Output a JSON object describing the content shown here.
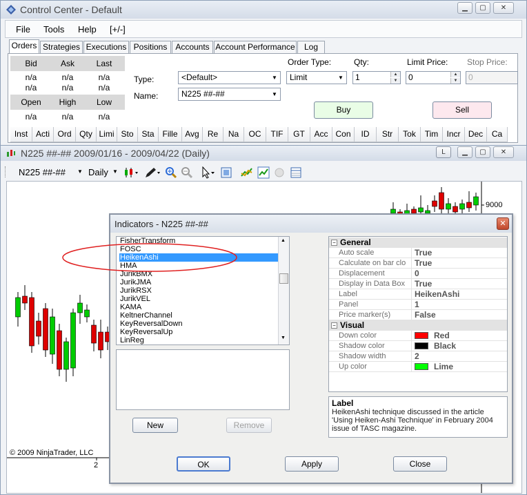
{
  "control_center": {
    "title": "Control Center - Default",
    "menu": [
      "File",
      "Tools",
      "Help",
      "[+/-]"
    ],
    "tabs": [
      "Orders",
      "Strategies",
      "Executions",
      "Positions",
      "Accounts",
      "Account Performance",
      "Log"
    ],
    "quote": {
      "row1_headers": [
        "Bid",
        "Ask",
        "Last"
      ],
      "row1_values": [
        "n/a",
        "n/a",
        "n/a"
      ],
      "row1_values_b": [
        "n/a",
        "n/a",
        "n/a"
      ],
      "row2_headers": [
        "Open",
        "High",
        "Low"
      ],
      "row2_values": [
        "n/a",
        "n/a",
        "n/a"
      ]
    },
    "order_entry": {
      "type_label": "Type:",
      "type_value": "<Default>",
      "name_label": "Name:",
      "name_value": "N225 ##-##",
      "order_type_label": "Order Type:",
      "order_type_value": "Limit",
      "qty_label": "Qty:",
      "qty_value": "1",
      "limit_price_label": "Limit Price:",
      "limit_price_value": "0",
      "stop_price_label": "Stop Price:",
      "stop_price_value": "0",
      "buy_label": "Buy",
      "sell_label": "Sell",
      "buy_color": "#e9fde6",
      "sell_color": "#fde8ee"
    },
    "columns": [
      "Inst",
      "Acti",
      "Ord",
      "Qty",
      "Limi",
      "Sto",
      "Sta",
      "Fille",
      "Avg",
      "Re",
      "Na",
      "OC",
      "TIF",
      "GT",
      "Acc",
      "Con",
      "ID",
      "Str",
      "Tok",
      "Tim",
      "Incr",
      "Dec",
      "Ca"
    ]
  },
  "chart_window": {
    "title": "N225 ##-##  2009/01/16 - 2009/04/22 (Daily)",
    "instrument": "N225 ##-##",
    "interval": "Daily",
    "price_label": "9000",
    "x_tick": "2",
    "copyright": "© 2009 NinjaTrader, LLC",
    "up_color": "#00cc00",
    "down_color": "#dd0000",
    "l_button": "L"
  },
  "dialog": {
    "title": "Indicators - N225 ##-##",
    "indicators": [
      "FisherTransform",
      "FOSC",
      "HeikenAshi",
      "HMA",
      "JurikBMX",
      "JurikJMA",
      "JurikRSX",
      "JurikVEL",
      "KAMA",
      "KeltnerChannel",
      "KeyReversalDown",
      "KeyReversalUp",
      "LinReg"
    ],
    "selected": "HeikenAshi",
    "general_label": "General",
    "general": [
      {
        "name": "Auto scale",
        "value": "True"
      },
      {
        "name": "Calculate on bar clo",
        "value": "True"
      },
      {
        "name": "Displacement",
        "value": "0"
      },
      {
        "name": "Display in Data Box",
        "value": "True"
      },
      {
        "name": "Label",
        "value": "HeikenAshi"
      },
      {
        "name": "Panel",
        "value": "1"
      },
      {
        "name": "Price marker(s)",
        "value": "False"
      }
    ],
    "visual_label": "Visual",
    "visual": [
      {
        "name": "Down color",
        "value": "Red",
        "color": "#ff0000"
      },
      {
        "name": "Shadow color",
        "value": "Black",
        "color": "#000000"
      },
      {
        "name": "Shadow width",
        "value": "2"
      },
      {
        "name": "Up color",
        "value": "Lime",
        "color": "#00ff00"
      }
    ],
    "description_title": "Label",
    "description": "HeikenAshi technique discussed in the article 'Using Heiken-Ashi Technique' in February 2004 issue of TASC magazine.",
    "new_label": "New",
    "remove_label": "Remove",
    "ok_label": "OK",
    "apply_label": "Apply",
    "close_label": "Close",
    "annotation_color": "#e02020"
  }
}
